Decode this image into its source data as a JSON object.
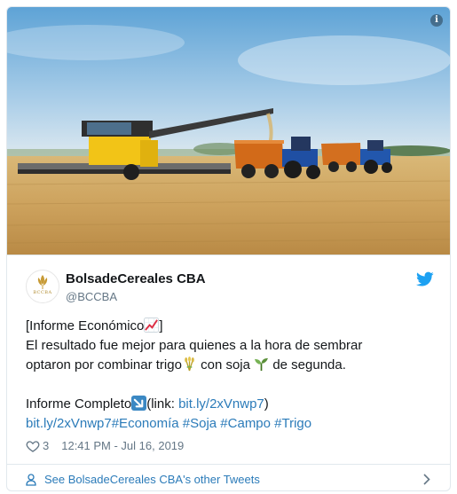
{
  "tweet": {
    "author_name": "BolsadeCereales CBA",
    "author_handle": "@BCCBA",
    "avatar_text": "BCCBA",
    "lines": {
      "l1_a": "[Informe Económico",
      "l1_b": "]",
      "l2": "El resultado fue mejor para quienes a la hora de sembrar",
      "l3_a": "optaron por combinar trigo",
      "l3_b": " con soja ",
      "l3_c": " de segunda.",
      "l4_a": "Informe Completo",
      "l4_b": "(link: ",
      "l4_link": "bit.ly/2xVnwp7",
      "l4_c": ")",
      "l5_link": "bit.ly/2xVnwp7",
      "l5_tags": "#Economía #Soja #Campo #Trigo"
    },
    "emojis": [
      "chart-increasing-emoji",
      "sheaf-of-rice-emoji",
      "seedling-emoji",
      "down-right-arrow-emoji"
    ],
    "likes": "3",
    "timestamp": "12:41 PM - Jul 16, 2019",
    "footer_label": "See BolsadeCereales CBA's other Tweets"
  },
  "colors": {
    "link": "#2b7bb9",
    "muted": "#657786",
    "twitter_blue": "#1da1f2"
  },
  "icons": {
    "info": "info-icon",
    "bird": "twitter-bird-icon",
    "heart": "heart-icon",
    "person": "person-icon",
    "chevron": "chevron-right-icon"
  }
}
